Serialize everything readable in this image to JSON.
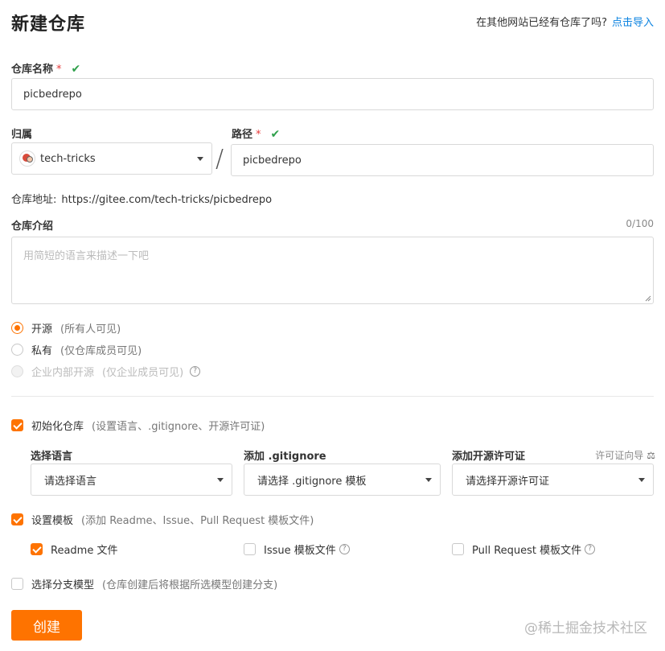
{
  "header": {
    "title": "新建仓库",
    "import_prompt": "在其他网站已经有仓库了吗?",
    "import_link": "点击导入"
  },
  "repo_name": {
    "label": "仓库名称",
    "required_mark": "*",
    "value": "picbedrepo",
    "valid_icon": "check-icon"
  },
  "owner": {
    "label": "归属",
    "value": "tech-tricks",
    "separator": "/"
  },
  "path": {
    "label": "路径",
    "required_mark": "*",
    "value": "picbedrepo"
  },
  "repo_address": {
    "label": "仓库地址:",
    "value": "https://gitee.com/tech-tricks/picbedrepo"
  },
  "description": {
    "label": "仓库介绍",
    "counter": "0/100",
    "placeholder": "用简短的语言来描述一下吧",
    "value": ""
  },
  "visibility": {
    "selected": "public",
    "options": [
      {
        "label": "开源",
        "hint": "(所有人可见)"
      },
      {
        "label": "私有",
        "hint": "(仅仓库成员可见)"
      },
      {
        "label": "企业内部开源",
        "hint": "(仅企业成员可见)"
      }
    ]
  },
  "init_repo": {
    "checked": true,
    "label": "初始化仓库",
    "hint": "(设置语言、.gitignore、开源许可证)",
    "language": {
      "label": "选择语言",
      "value": "请选择语言"
    },
    "gitignore": {
      "label": "添加 .gitignore",
      "value": "请选择 .gitignore 模板"
    },
    "license": {
      "label": "添加开源许可证",
      "value": "请选择开源许可证",
      "guide": "许可证向导"
    }
  },
  "template": {
    "checked": true,
    "label": "设置模板",
    "hint": "(添加 Readme、Issue、Pull Request 模板文件)",
    "options": [
      {
        "label": "Readme 文件",
        "checked": true
      },
      {
        "label": "Issue 模板文件",
        "checked": false
      },
      {
        "label": "Pull Request 模板文件",
        "checked": false
      }
    ]
  },
  "branch_model": {
    "checked": false,
    "label": "选择分支模型",
    "hint": "(仓库创建后将根据所选模型创建分支)"
  },
  "submit": {
    "label": "创建"
  },
  "watermark": "@稀土掘金技术社区",
  "colors": {
    "accent": "#fe7300",
    "link": "#0a82e0",
    "valid": "#2fa04b",
    "required": "#e63b3b"
  }
}
